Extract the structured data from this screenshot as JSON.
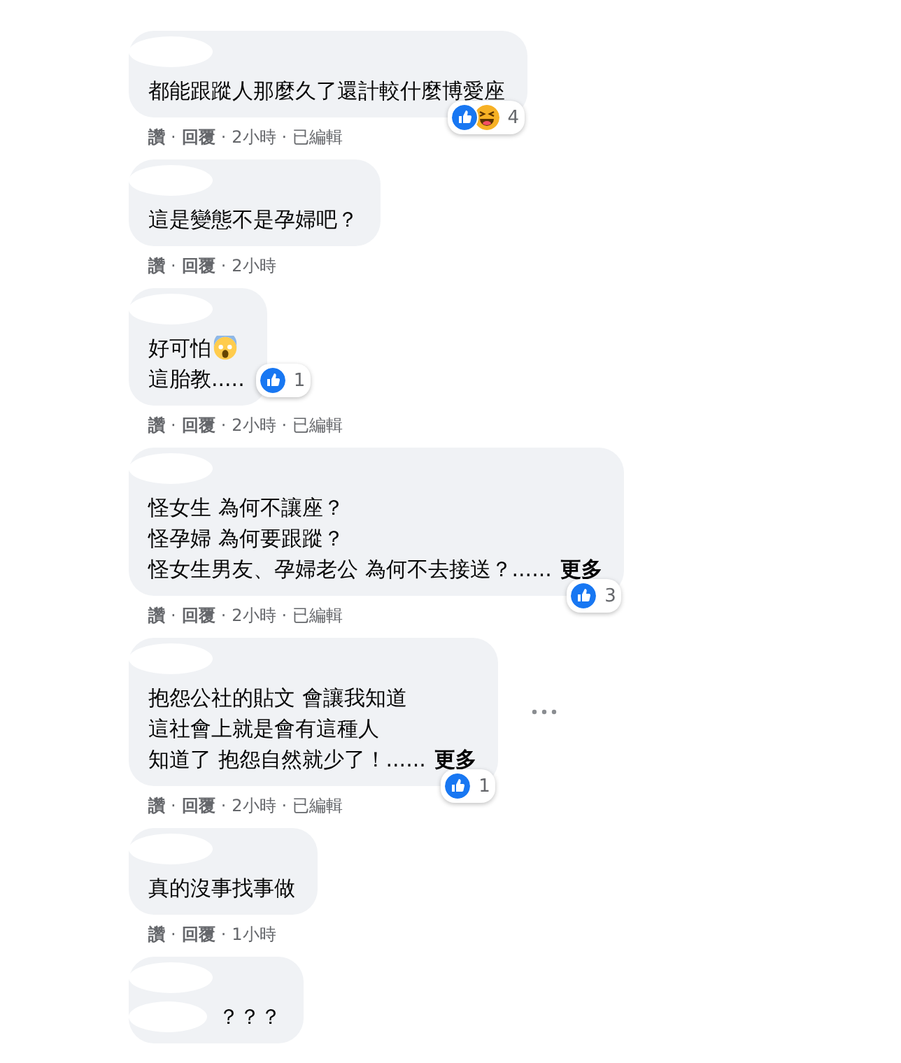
{
  "comments": [
    {
      "lines": [
        {
          "text": "都能跟蹤人那麼久了還計較什麼博愛座",
          "trailing_icon": false
        }
      ],
      "reactions": {
        "beside_text": false,
        "items": [
          {
            "kind": "like"
          },
          {
            "kind": "haha"
          }
        ],
        "count": "4"
      },
      "actions": [
        {
          "label": "讚",
          "kind": "link"
        },
        {
          "label": "·",
          "kind": "sep"
        },
        {
          "label": "回覆",
          "kind": "link"
        },
        {
          "label": "·",
          "kind": "sep"
        },
        {
          "label": "2小時",
          "kind": "meta"
        },
        {
          "label": "·",
          "kind": "sep"
        },
        {
          "label": "已編輯",
          "kind": "meta"
        }
      ],
      "menu": false
    },
    {
      "lines": [
        {
          "text": "這是變態不是孕婦吧？",
          "trailing_icon": false
        }
      ],
      "actions": [
        {
          "label": "讚",
          "kind": "link"
        },
        {
          "label": "·",
          "kind": "sep"
        },
        {
          "label": "回覆",
          "kind": "link"
        },
        {
          "label": "·",
          "kind": "sep"
        },
        {
          "label": "2小時",
          "kind": "meta"
        }
      ],
      "menu": false
    },
    {
      "lines": [
        {
          "text": "好可怕",
          "trailing_icon": true
        },
        {
          "text": "這胎教.....",
          "trailing_icon": false
        }
      ],
      "reactions": {
        "beside_text": true,
        "items": [
          {
            "kind": "like"
          }
        ],
        "count": "1"
      },
      "actions": [
        {
          "label": "讚",
          "kind": "link"
        },
        {
          "label": "·",
          "kind": "sep"
        },
        {
          "label": "回覆",
          "kind": "link"
        },
        {
          "label": "·",
          "kind": "sep"
        },
        {
          "label": "2小時",
          "kind": "meta"
        },
        {
          "label": "·",
          "kind": "sep"
        },
        {
          "label": "已編輯",
          "kind": "meta"
        }
      ],
      "menu": false
    },
    {
      "lines": [
        {
          "text": "怪女生 為何不讓座？",
          "trailing_icon": false
        },
        {
          "text": "怪孕婦 為何要跟蹤？",
          "trailing_icon": false
        },
        {
          "text": "怪女生男友、孕婦老公 為何不去接送？......",
          "trailing_icon": false
        }
      ],
      "more": "更多",
      "reactions": {
        "beside_text": false,
        "items": [
          {
            "kind": "like"
          }
        ],
        "count": "3"
      },
      "actions": [
        {
          "label": "讚",
          "kind": "link"
        },
        {
          "label": "·",
          "kind": "sep"
        },
        {
          "label": "回覆",
          "kind": "link"
        },
        {
          "label": "·",
          "kind": "sep"
        },
        {
          "label": "2小時",
          "kind": "meta"
        },
        {
          "label": "·",
          "kind": "sep"
        },
        {
          "label": "已編輯",
          "kind": "meta"
        }
      ],
      "menu": false
    },
    {
      "lines": [
        {
          "text": "抱怨公社的貼文 會讓我知道",
          "trailing_icon": false
        },
        {
          "text": "這社會上就是會有這種人",
          "trailing_icon": false
        },
        {
          "text": "知道了 抱怨自然就少了！......",
          "trailing_icon": false
        }
      ],
      "more": "更多",
      "reactions": {
        "beside_text": false,
        "items": [
          {
            "kind": "like"
          }
        ],
        "count": "1"
      },
      "actions": [
        {
          "label": "讚",
          "kind": "link"
        },
        {
          "label": "·",
          "kind": "sep"
        },
        {
          "label": "回覆",
          "kind": "link"
        },
        {
          "label": "·",
          "kind": "sep"
        },
        {
          "label": "2小時",
          "kind": "meta"
        },
        {
          "label": "·",
          "kind": "sep"
        },
        {
          "label": "已編輯",
          "kind": "meta"
        }
      ],
      "menu": true
    },
    {
      "lines": [
        {
          "text": "真的沒事找事做",
          "trailing_icon": false
        }
      ],
      "actions": [
        {
          "label": "讚",
          "kind": "link"
        },
        {
          "label": "·",
          "kind": "sep"
        },
        {
          "label": "回覆",
          "kind": "link"
        },
        {
          "label": "·",
          "kind": "sep"
        },
        {
          "label": "1小時",
          "kind": "meta"
        }
      ],
      "menu": false
    },
    {
      "lines": [
        {
          "text": "？？？",
          "trailing_icon": false,
          "redacted_prefix": true
        }
      ],
      "menu": false
    }
  ]
}
